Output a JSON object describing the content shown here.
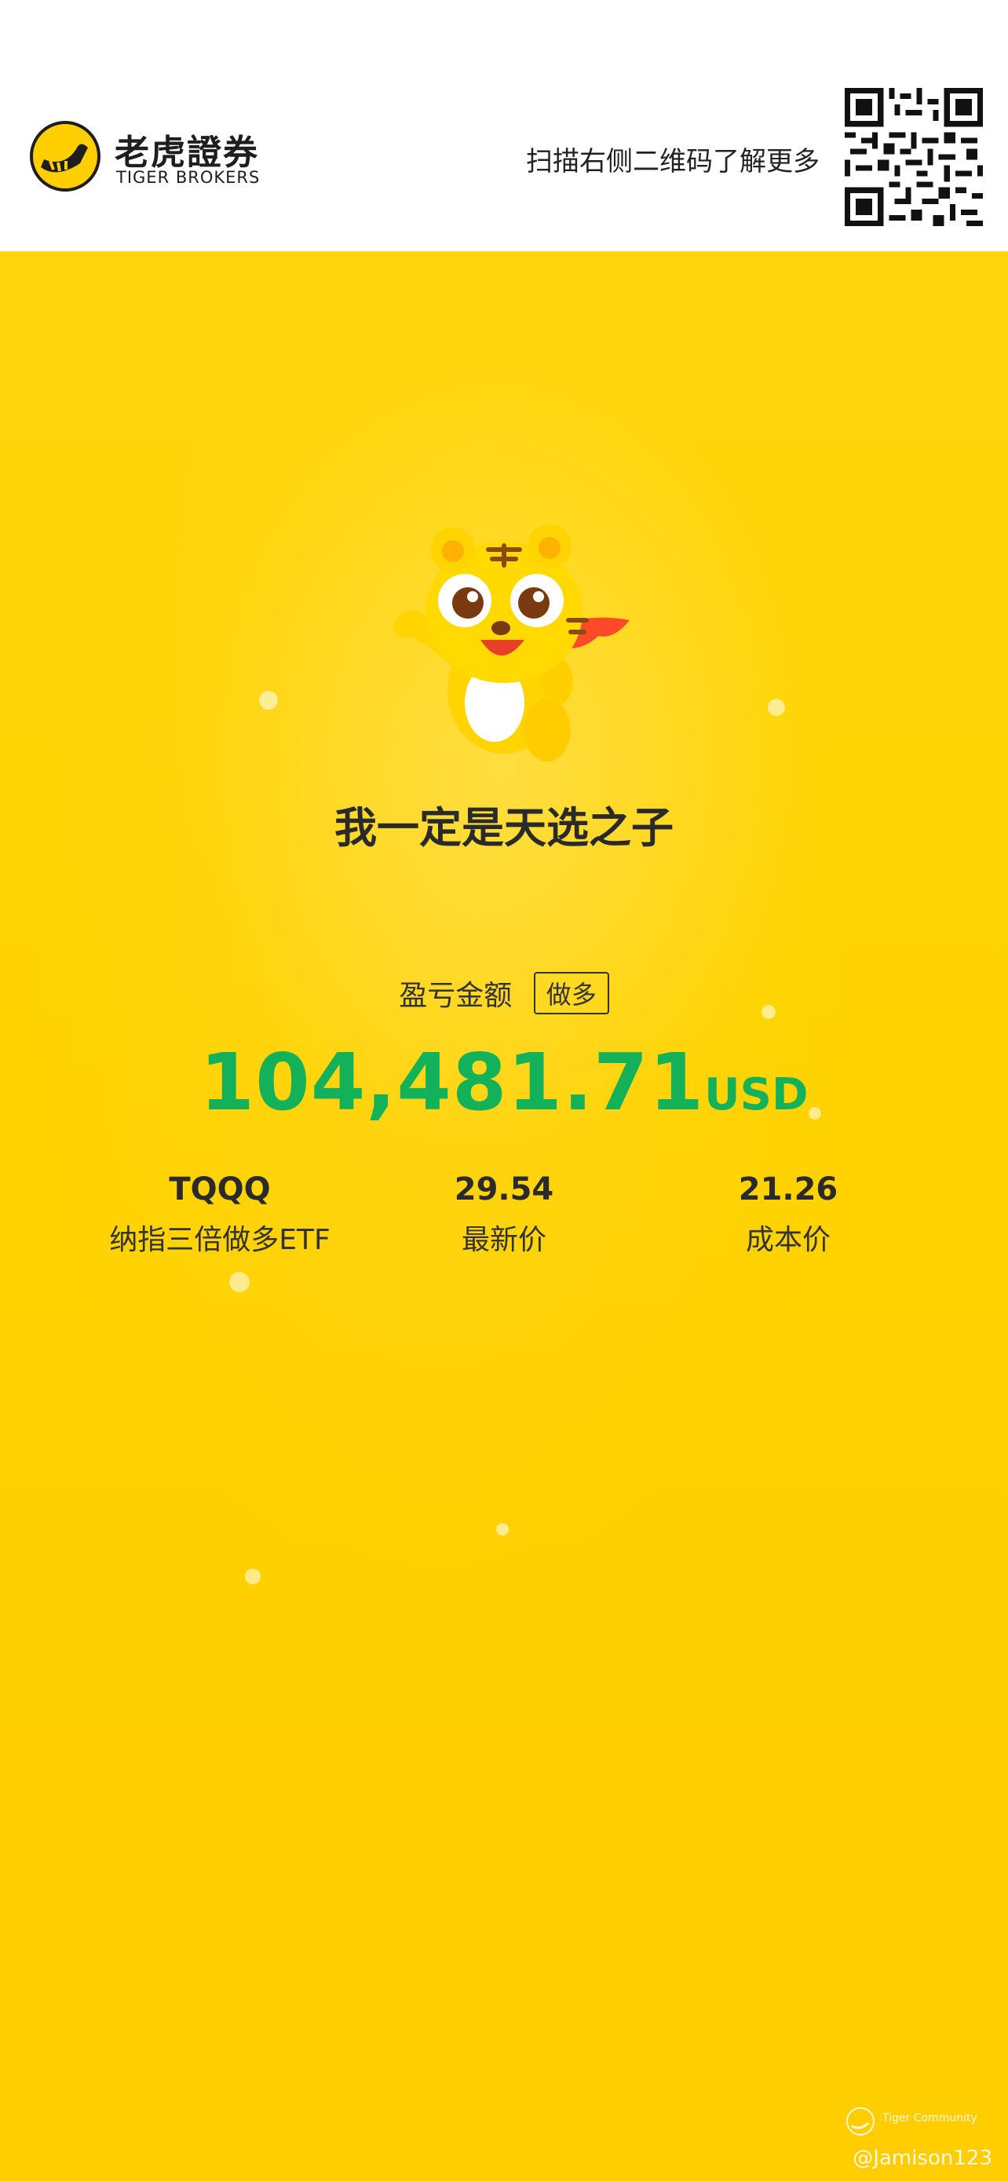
{
  "header": {
    "brand_cn": "老虎證券",
    "brand_en": "TIGER BROKERS",
    "scan_tip": "扫描右侧二维码了解更多"
  },
  "main": {
    "slogan": "我一定是天选之子",
    "pl_label": "盈亏金额",
    "direction_badge": "做多",
    "amount": "104,481.71",
    "currency": "USD"
  },
  "stats": [
    {
      "value": "TQQQ",
      "label": "纳指三倍做多ETF"
    },
    {
      "value": "29.54",
      "label": "最新价"
    },
    {
      "value": "21.26",
      "label": "成本价"
    }
  ],
  "footer": {
    "community": "Tiger Community",
    "username": "@Jamison123"
  },
  "colors": {
    "background": "#ffd200",
    "profit_green": "#13b25a",
    "header_bg": "#ffffff"
  },
  "icons": [
    "tiger-logo-icon",
    "qr-code-icon",
    "tiger-mascot-icon",
    "tiger-community-icon"
  ]
}
